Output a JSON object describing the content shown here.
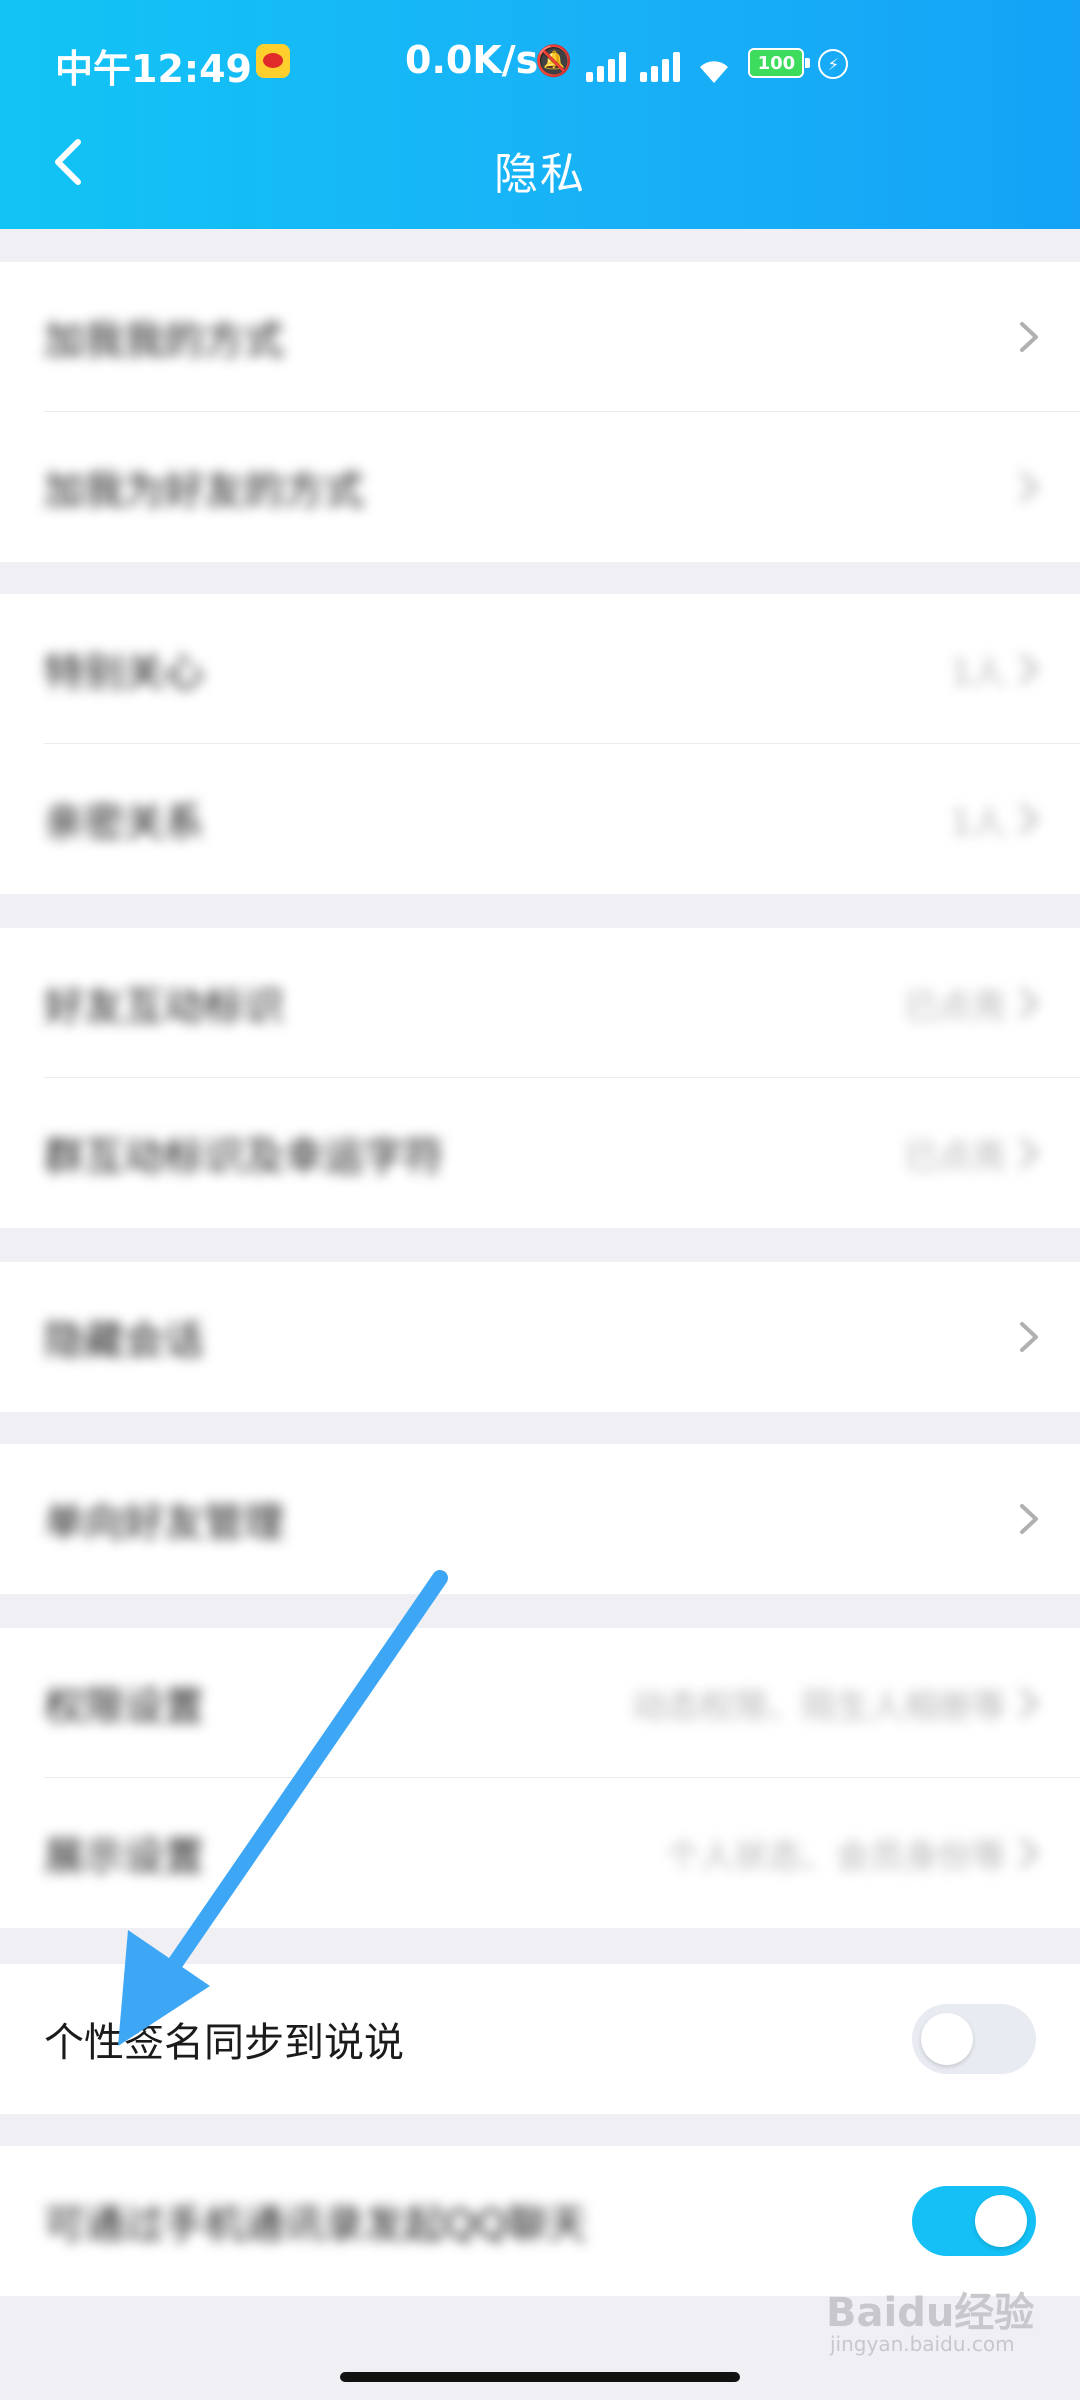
{
  "status_bar": {
    "time": "中午12:49",
    "net_speed": "0.0K/s",
    "battery": "100"
  },
  "header": {
    "title": "隐私"
  },
  "groups": [
    {
      "rows": [
        {
          "label": "加我我的方式",
          "value": ""
        },
        {
          "label": "加我为好友的方式",
          "value": ""
        }
      ]
    },
    {
      "rows": [
        {
          "label": "特别关心",
          "value": "1人"
        },
        {
          "label": "亲密关系",
          "value": "1人"
        }
      ]
    },
    {
      "rows": [
        {
          "label": "好友互动标识",
          "value": "已点亮"
        },
        {
          "label": "群互动标识及幸运字符",
          "value": "已点亮"
        }
      ]
    },
    {
      "rows": [
        {
          "label": "隐藏会话",
          "value": ""
        }
      ]
    },
    {
      "rows": [
        {
          "label": "单向好友管理",
          "value": ""
        }
      ]
    },
    {
      "rows": [
        {
          "label": "权限设置",
          "value": "动态权限、陌生人相册等"
        },
        {
          "label": "展示设置",
          "value": "个人状态、会员身份等"
        }
      ]
    }
  ],
  "toggle_rows": [
    {
      "label": "个性签名同步到说说",
      "state": "off"
    },
    {
      "label": "可通过手机通讯录发起QQ聊天",
      "state": "on"
    }
  ],
  "watermark": {
    "brand": "Baidu经验",
    "url": "jingyan.baidu.com"
  },
  "colors": {
    "header_start": "#12c4f5",
    "header_end": "#14a3f7",
    "toggle_on": "#14c0f5",
    "arrow": "#3ea7f5"
  }
}
